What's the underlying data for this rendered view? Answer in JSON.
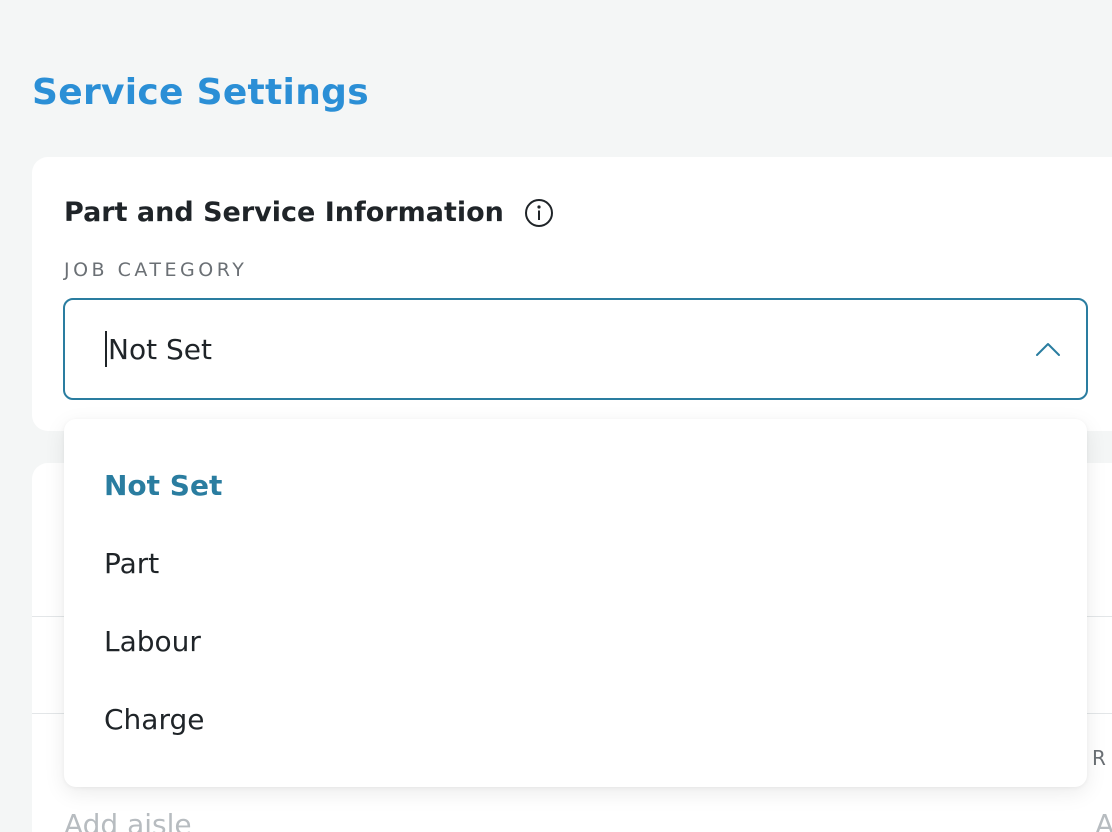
{
  "page": {
    "title": "Service Settings"
  },
  "card": {
    "title": "Part and Service Information",
    "info_icon": "info-circle-icon"
  },
  "job_category": {
    "label": "JOB CATEGORY",
    "value": "Not Set",
    "expanded": true,
    "options": [
      "Not Set",
      "Part",
      "Labour",
      "Charge"
    ],
    "selected_index": 0
  },
  "background_card": {
    "aisle_placeholder": "Add aisle",
    "right_label_fragment": "R",
    "right_placeholder_fragment": "A"
  },
  "colors": {
    "title_blue": "#2b8fd6",
    "accent_teal": "#2a7da0",
    "page_bg": "#f4f6f6"
  }
}
